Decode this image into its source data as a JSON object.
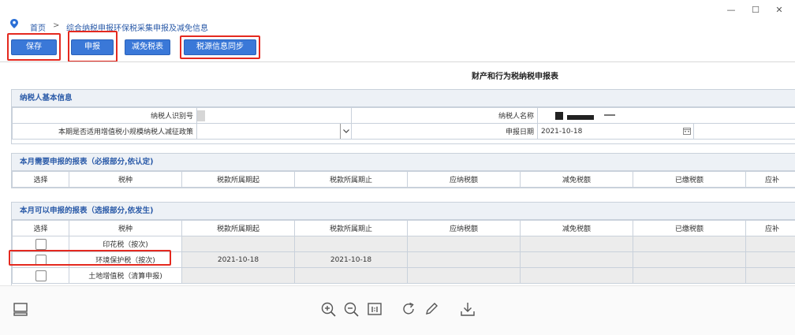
{
  "breadcrumb": {
    "home": "首页",
    "separator": ">",
    "current": "综合纳税申报环保税采集申报及减免信息"
  },
  "window_controls": {
    "minimize": "—",
    "maximize": "☐",
    "close": "✕"
  },
  "toolbar": {
    "save": "保存",
    "declare": "申报",
    "relief": "减免税表",
    "sync": "税源信息同步"
  },
  "report_title": "财产和行为税纳税申报表",
  "taxpayer": {
    "title": "纳税人基本信息",
    "id_label": "纳税人识别号",
    "name_label": "纳税人名称",
    "policy_label": "本期是否适用增值税小规模纳税人减征政策",
    "date_label": "申报日期",
    "date_value": "2021-10-18"
  },
  "required_section": {
    "title": "本月需要申报的报表（必报部分,依认定)",
    "columns": [
      "选择",
      "税种",
      "税款所属期起",
      "税款所属期止",
      "应纳税额",
      "减免税额",
      "已缴税额",
      "应补"
    ]
  },
  "optional_section": {
    "title": "本月可以申报的报表（选报部分,依发生)",
    "columns": [
      "选择",
      "税种",
      "税款所属期起",
      "税款所属期止",
      "应纳税额",
      "减免税额",
      "已缴税额",
      "应补"
    ],
    "rows": [
      {
        "tax": "印花税（按次)",
        "start": "",
        "end": ""
      },
      {
        "tax": "环境保护税（按次)",
        "start": "2021-10-18",
        "end": "2021-10-18"
      },
      {
        "tax": "土地增值税（清算申报)",
        "start": "",
        "end": ""
      }
    ]
  },
  "colors": {
    "accent": "#3a78d8",
    "highlight": "#e4291f",
    "section_title": "#2a5aa8"
  },
  "icons": [
    "location-pin-icon",
    "panel-toggle-icon",
    "zoom-in-icon",
    "zoom-out-icon",
    "actual-size-icon",
    "rotate-icon",
    "edit-pen-icon",
    "download-icon"
  ]
}
